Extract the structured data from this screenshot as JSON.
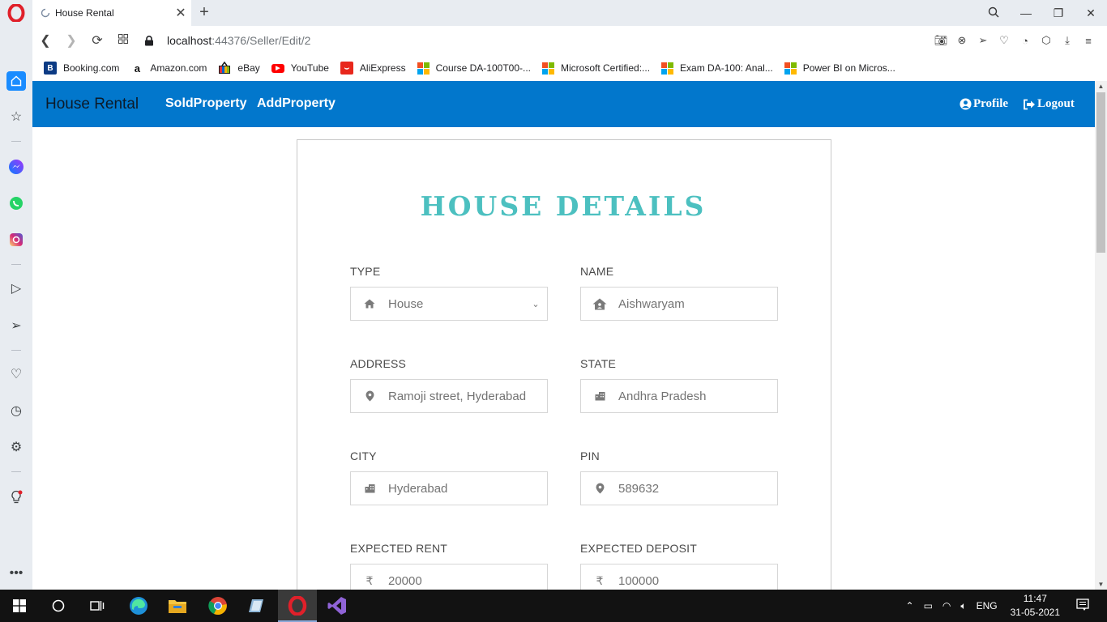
{
  "browser": {
    "tab": {
      "title": "House Rental"
    },
    "url": {
      "host": "localhost",
      "path": ":44376/Seller/Edit/2"
    },
    "bookmarks": [
      {
        "label": "Booking.com",
        "icon": "booking-icon"
      },
      {
        "label": "Amazon.com",
        "icon": "amazon-icon"
      },
      {
        "label": "eBay",
        "icon": "ebay-icon"
      },
      {
        "label": "YouTube",
        "icon": "youtube-icon"
      },
      {
        "label": "AliExpress",
        "icon": "aliexpress-icon"
      },
      {
        "label": "Course DA-100T00-...",
        "icon": "microsoft-icon"
      },
      {
        "label": "Microsoft Certified:...",
        "icon": "microsoft-icon"
      },
      {
        "label": "Exam DA-100: Anal...",
        "icon": "microsoft-icon"
      },
      {
        "label": "Power BI on Micros...",
        "icon": "microsoft-icon"
      }
    ]
  },
  "navbar": {
    "brand": "House Rental",
    "links": [
      "SoldProperty",
      "AddProperty"
    ],
    "profile": "Profile",
    "logout": "Logout",
    "color": "#0277cc"
  },
  "form": {
    "title": "HOUSE DETAILS",
    "title_color": "#4cc0c0",
    "fields": {
      "type": {
        "label": "TYPE",
        "value": "House",
        "icon": "home-icon"
      },
      "name": {
        "label": "NAME",
        "value": "Aishwaryam",
        "icon": "house-user-icon"
      },
      "address": {
        "label": "ADDRESS",
        "value": "Ramoji street, Hyderabad",
        "icon": "map-marker-icon"
      },
      "state": {
        "label": "STATE",
        "value": "Andhra Pradesh",
        "icon": "building-icon"
      },
      "city": {
        "label": "CITY",
        "value": "Hyderabad",
        "icon": "building-icon"
      },
      "pin": {
        "label": "PIN",
        "value": "589632",
        "icon": "map-marker-icon"
      },
      "rent": {
        "label": "EXPECTED RENT",
        "value": "20000",
        "icon": "rupee-icon"
      },
      "deposit": {
        "label": "EXPECTED DEPOSIT",
        "value": "100000",
        "icon": "rupee-icon"
      }
    }
  },
  "taskbar": {
    "lang": "ENG",
    "time": "11:47",
    "date": "31-05-2021"
  }
}
